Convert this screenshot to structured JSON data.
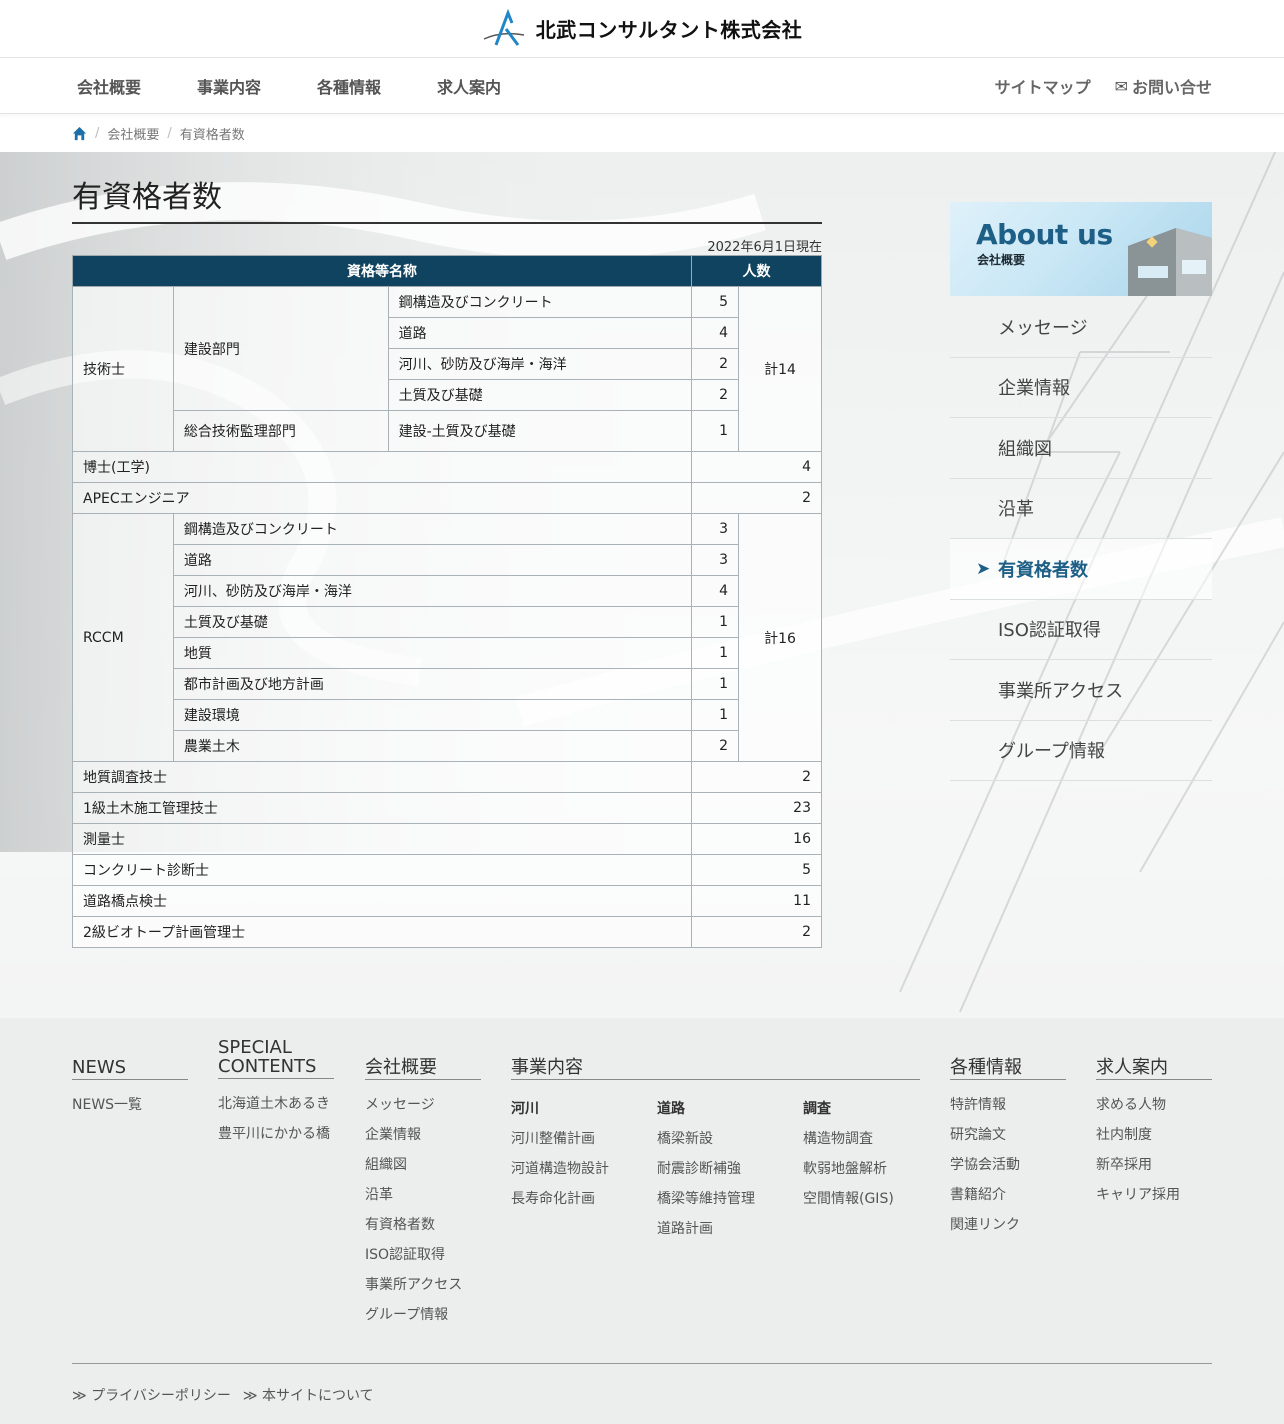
{
  "header": {
    "company": "北武コンサルタント株式会社"
  },
  "nav": {
    "left": [
      "会社概要",
      "事業内容",
      "各種情報",
      "求人案内"
    ],
    "sitemap": "サイトマップ",
    "contact": "お問い合せ"
  },
  "breadcrumb": {
    "level1": "会社概要",
    "current": "有資格者数"
  },
  "page": {
    "title": "有資格者数",
    "as_of": "2022年6月1日現在"
  },
  "table": {
    "head_name": "資格等名称",
    "head_count": "人数",
    "engineer": {
      "label": "技術士",
      "dept1": "建設部門",
      "dept2": "総合技術監理部門",
      "items": [
        {
          "name": "鋼構造及びコンクリート",
          "count": "5"
        },
        {
          "name": "道路",
          "count": "4"
        },
        {
          "name": "河川、砂防及び海岸・海洋",
          "count": "2"
        },
        {
          "name": "土質及び基礎",
          "count": "2"
        },
        {
          "name": "建設-土質及び基礎",
          "count": "1"
        }
      ],
      "total": "計14"
    },
    "doctor": {
      "name": "博士(工学)",
      "count": "4"
    },
    "apec": {
      "name": "APECエンジニア",
      "count": "2"
    },
    "rccm": {
      "label": "RCCM",
      "items": [
        {
          "name": "鋼構造及びコンクリート",
          "count": "3"
        },
        {
          "name": "道路",
          "count": "3"
        },
        {
          "name": "河川、砂防及び海岸・海洋",
          "count": "4"
        },
        {
          "name": "土質及び基礎",
          "count": "1"
        },
        {
          "name": "地質",
          "count": "1"
        },
        {
          "name": "都市計画及び地方計画",
          "count": "1"
        },
        {
          "name": "建設環境",
          "count": "1"
        },
        {
          "name": "農業土木",
          "count": "2"
        }
      ],
      "total": "計16"
    },
    "others": [
      {
        "name": "地質調査技士",
        "count": "2"
      },
      {
        "name": "1級土木施工管理技士",
        "count": "23"
      },
      {
        "name": "測量士",
        "count": "16"
      },
      {
        "name": "コンクリート診断士",
        "count": "5"
      },
      {
        "name": "道路橋点検士",
        "count": "11"
      },
      {
        "name": "2級ビオトープ計画管理士",
        "count": "2"
      }
    ]
  },
  "sidebar": {
    "banner_title": "About us",
    "banner_sub": "会社概要",
    "items": [
      "メッセージ",
      "企業情報",
      "組織図",
      "沿革",
      "有資格者数",
      "ISO認証取得",
      "事業所アクセス",
      "グループ情報"
    ],
    "active_index": 4
  },
  "footer": {
    "news": {
      "head": "NEWS",
      "links": [
        "NEWS一覧"
      ]
    },
    "special": {
      "head1": "SPECIAL",
      "head2": "CONTENTS",
      "links": [
        "北海道土木あるき",
        "豊平川にかかる橋"
      ]
    },
    "company": {
      "head": "会社概要",
      "links": [
        "メッセージ",
        "企業情報",
        "組織図",
        "沿革",
        "有資格者数",
        "ISO認証取得",
        "事業所アクセス",
        "グループ情報"
      ]
    },
    "business": {
      "head": "事業内容",
      "cols": [
        {
          "sub": "河川",
          "links": [
            "河川整備計画",
            "河道構造物設計",
            "長寿命化計画"
          ]
        },
        {
          "sub": "道路",
          "links": [
            "橋梁新設",
            "耐震診断補強",
            "橋梁等維持管理",
            "道路計画"
          ]
        },
        {
          "sub": "調査",
          "links": [
            "構造物調査",
            "軟弱地盤解析",
            "空間情報(GIS)"
          ]
        }
      ]
    },
    "info": {
      "head": "各種情報",
      "links": [
        "特許情報",
        "研究論文",
        "学協会活動",
        "書籍紹介",
        "関連リンク"
      ]
    },
    "recruit": {
      "head": "求人案内",
      "links": [
        "求める人物",
        "社内制度",
        "新卒採用",
        "キャリア採用"
      ]
    },
    "bottom": [
      "プライバシーポリシー",
      "本サイトについて"
    ]
  },
  "colors": {
    "table_header": "#10435f",
    "accent": "#1d5f86"
  }
}
